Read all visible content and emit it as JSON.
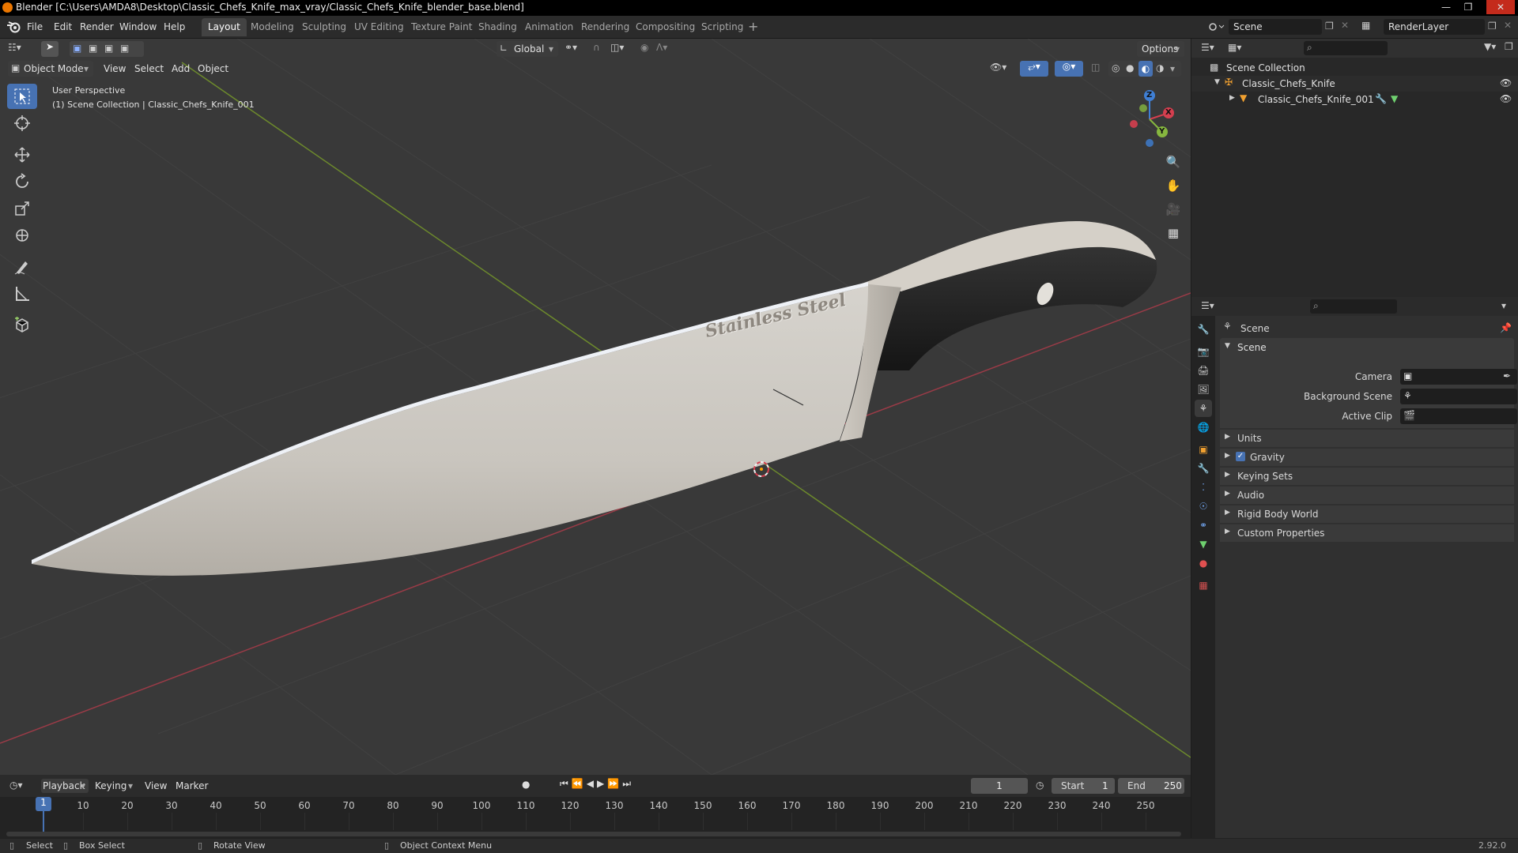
{
  "window": {
    "title": "Blender [C:\\Users\\AMDA8\\Desktop\\Classic_Chefs_Knife_max_vray/Classic_Chefs_Knife_blender_base.blend]"
  },
  "menu": [
    "File",
    "Edit",
    "Render",
    "Window",
    "Help"
  ],
  "workspaces": [
    "Layout",
    "Modeling",
    "Sculpting",
    "UV Editing",
    "Texture Paint",
    "Shading",
    "Animation",
    "Rendering",
    "Compositing",
    "Scripting"
  ],
  "active_workspace": "Layout",
  "top_right": {
    "scene": "Scene",
    "view_layer": "RenderLayer"
  },
  "toolbar_header": {
    "transform_orientation": "Global",
    "options": "Options"
  },
  "viewport_header": {
    "mode": "Object Mode",
    "menus": [
      "View",
      "Select",
      "Add",
      "Object"
    ]
  },
  "viewport_overlay": {
    "perspective": "User Perspective",
    "collection": "(1) Scene Collection | Classic_Chefs_Knife_001"
  },
  "knife": {
    "engraving": "Stainless Steel"
  },
  "gizmo": {
    "x": "X",
    "y": "Y",
    "z": "Z"
  },
  "colors": {
    "accent": "#4772b3",
    "x_axis": "#d53f4f",
    "y_axis": "#86b73f",
    "z_axis": "#3f7fd5",
    "blender_orange": "#ea7600"
  },
  "outliner": {
    "root": "Scene Collection",
    "collection": "Classic_Chefs_Knife",
    "object": "Classic_Chefs_Knife_001"
  },
  "properties": {
    "context": "Scene",
    "panel": "Scene",
    "fields": [
      {
        "label": "Camera"
      },
      {
        "label": "Background Scene"
      },
      {
        "label": "Active Clip"
      }
    ],
    "subpanels": [
      {
        "label": "Units"
      },
      {
        "label": "Gravity",
        "checked": true
      },
      {
        "label": "Keying Sets"
      },
      {
        "label": "Audio"
      },
      {
        "label": "Rigid Body World"
      },
      {
        "label": "Custom Properties"
      }
    ]
  },
  "timeline": {
    "menus": [
      "Playback",
      "Keying",
      "View",
      "Marker"
    ],
    "current_frame": "1",
    "start_label": "Start",
    "start": "1",
    "end_label": "End",
    "end": "250",
    "ticks": [
      "1",
      "10",
      "20",
      "30",
      "40",
      "50",
      "60",
      "70",
      "80",
      "90",
      "100",
      "110",
      "120",
      "130",
      "140",
      "150",
      "160",
      "170",
      "180",
      "190",
      "200",
      "210",
      "220",
      "230",
      "240",
      "250"
    ]
  },
  "statusbar": {
    "select": "Select",
    "box_select": "Box Select",
    "rotate_view": "Rotate View",
    "context_menu": "Object Context Menu",
    "version": "2.92.0"
  }
}
